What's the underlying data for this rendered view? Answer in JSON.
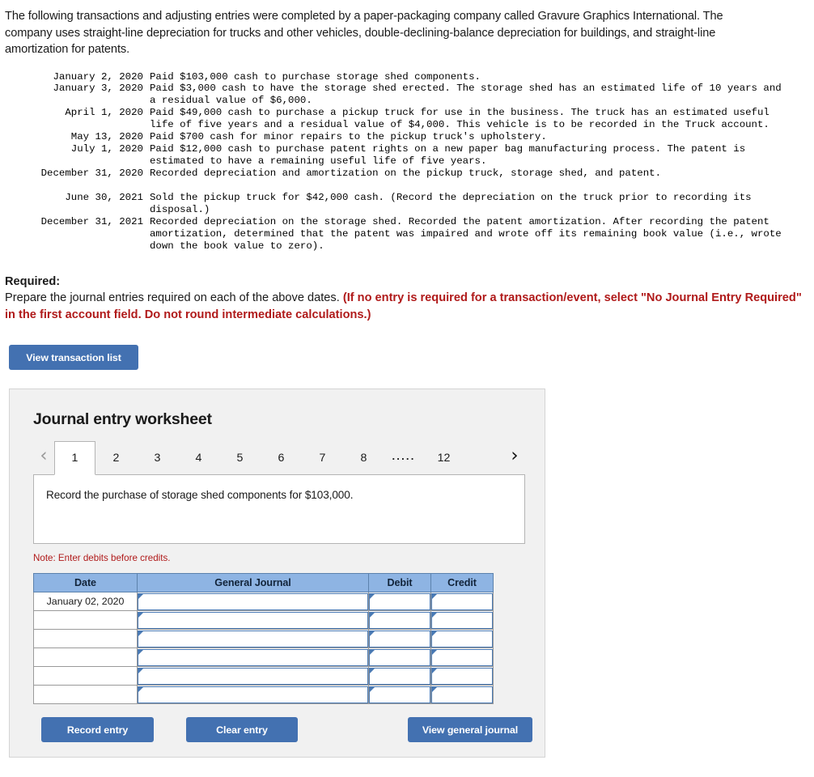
{
  "intro": {
    "paragraph": "The following transactions and adjusting entries were completed by a paper-packaging company called Gravure Graphics International. The company uses straight-line depreciation for trucks and other vehicles, double-declining-balance depreciation for buildings, and straight-line amortization for patents."
  },
  "transactions": [
    {
      "date": "January 2, 2020",
      "description": "Paid $103,000 cash to purchase storage shed components."
    },
    {
      "date": "January 3, 2020",
      "description": "Paid $3,000 cash to have the storage shed erected. The storage shed has an estimated life of 10 years and a residual value of $6,000."
    },
    {
      "date": "April 1, 2020",
      "description": "Paid $49,000 cash to purchase a pickup truck for use in the business. The truck has an estimated useful life of five years and a residual value of $4,000. This vehicle is to be recorded in the Truck account."
    },
    {
      "date": "May 13, 2020",
      "description": "Paid $700 cash for minor repairs to the pickup truck's upholstery."
    },
    {
      "date": "July 1, 2020",
      "description": "Paid $12,000 cash to purchase patent rights on a new paper bag manufacturing process. The patent is estimated to have a remaining useful life of five years."
    },
    {
      "date": "December 31, 2020",
      "description": "Recorded depreciation and amortization on the pickup truck, storage shed, and patent."
    },
    {
      "date": "",
      "description": ""
    },
    {
      "date": "June 30, 2021",
      "description": "Sold the pickup truck for $42,000 cash. (Record the depreciation on the truck prior to recording its disposal.)"
    },
    {
      "date": "December 31, 2021",
      "description": "Recorded depreciation on the storage shed. Recorded the patent amortization. After recording the patent amortization, determined that the patent was impaired and wrote off its remaining book value (i.e., wrote down the book value to zero)."
    }
  ],
  "required": {
    "label": "Required:",
    "text": "Prepare the journal entries required on each of the above dates.",
    "emphasis": "(If no entry is required for a transaction/event, select \"No Journal Entry Required\" in the first account field. Do not round intermediate calculations.)"
  },
  "buttons": {
    "view_transaction_list": "View transaction list",
    "record_entry": "Record entry",
    "clear_entry": "Clear entry",
    "view_general_journal": "View general journal"
  },
  "worksheet": {
    "title": "Journal entry worksheet",
    "prev_arrow": "‹",
    "next_arrow": "›",
    "tabs": [
      {
        "label": "1",
        "active": true
      },
      {
        "label": "2",
        "active": false
      },
      {
        "label": "3",
        "active": false
      },
      {
        "label": "4",
        "active": false
      },
      {
        "label": "5",
        "active": false
      },
      {
        "label": "6",
        "active": false
      },
      {
        "label": "7",
        "active": false
      },
      {
        "label": "8",
        "active": false
      },
      {
        "label": ".....",
        "active": false
      },
      {
        "label": "12",
        "active": false
      }
    ],
    "prompt": "Record the purchase of storage shed components for $103,000.",
    "note": "Note: Enter debits before credits.",
    "table": {
      "headers": [
        "Date",
        "General Journal",
        "Debit",
        "Credit"
      ],
      "rows": [
        {
          "date": "January 02, 2020",
          "general_journal": "",
          "debit": "",
          "credit": ""
        },
        {
          "date": "",
          "general_journal": "",
          "debit": "",
          "credit": ""
        },
        {
          "date": "",
          "general_journal": "",
          "debit": "",
          "credit": ""
        },
        {
          "date": "",
          "general_journal": "",
          "debit": "",
          "credit": ""
        },
        {
          "date": "",
          "general_journal": "",
          "debit": "",
          "credit": ""
        },
        {
          "date": "",
          "general_journal": "",
          "debit": "",
          "credit": ""
        }
      ]
    }
  },
  "colors": {
    "button_blue": "#4371b1",
    "table_header_blue": "#8eb4e3",
    "cell_border_blue": "#4a7ab4",
    "alert_red": "#b01a1a",
    "panel_bg": "#f1f1f1"
  }
}
